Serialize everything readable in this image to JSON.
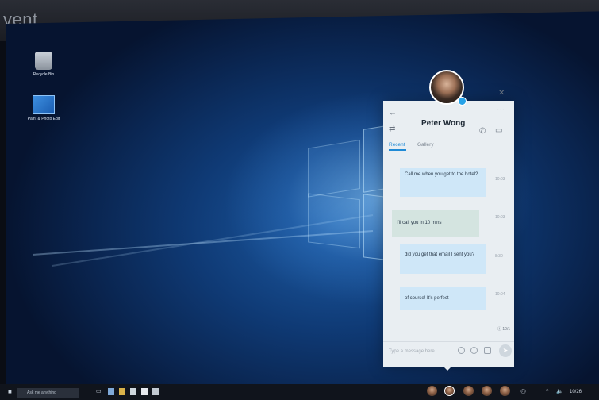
{
  "overlay": {
    "event_text": "vent"
  },
  "desktop": {
    "icons": [
      {
        "name": "recycle-bin",
        "label": "Recycle Bin"
      },
      {
        "name": "photos",
        "label": "Paint & Photo Edit"
      }
    ]
  },
  "chat": {
    "contact_name": "Peter Wong",
    "tabs": [
      "Recent",
      "Gallery"
    ],
    "messages": [
      {
        "text": "Call me when you get to the hotel?",
        "time": "10:03",
        "direction": "in"
      },
      {
        "text": "I'll call you in 10 mins",
        "time": "10:03",
        "direction": "out"
      },
      {
        "text": "did you get that email I sent you?",
        "time": "8:30",
        "direction": "in"
      },
      {
        "text": "of course! It's perfect",
        "time": "10:04",
        "direction": "in"
      }
    ],
    "seen_label": "Ⓘ 10/1",
    "compose_placeholder": "Type a message here",
    "icons": {
      "back": "←",
      "close": "✕",
      "more": "···",
      "swap": "⇄",
      "phone": "✆",
      "video": "▭",
      "send": "➤"
    }
  },
  "taskbar": {
    "search_placeholder": "Ask me anything",
    "clock": "10/26",
    "tray_up": "^",
    "volume": "🔈"
  },
  "colors": {
    "accent": "#1f8ad6",
    "desktop": "#0f3a75",
    "bubble_in": "#cfe7f8",
    "bubble_out": "#d4e4e0"
  }
}
